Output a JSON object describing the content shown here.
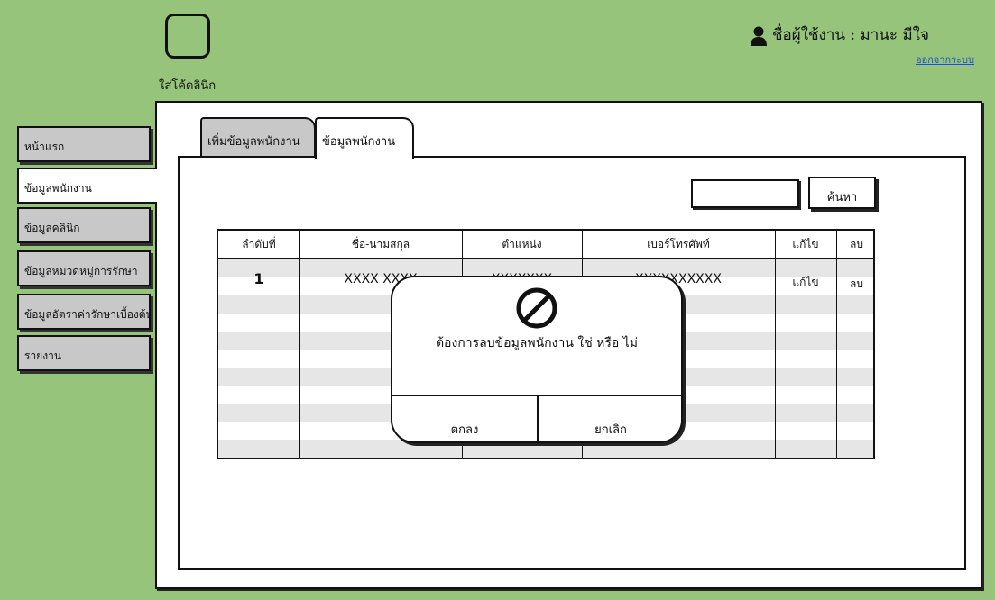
{
  "app": {
    "logo_text": "ใส่โค้ดลินิก",
    "user_text": "ชื่อผู้ใช้งาน : มานะ  มีใจ",
    "logout_label": "ออกจากระบบ"
  },
  "sidebar": {
    "items": [
      {
        "label": "หน้าแรก",
        "active": false
      },
      {
        "label": "ข้อมูลพนักงาน",
        "active": true
      },
      {
        "label": "ข้อมูลคลินิก",
        "active": false
      },
      {
        "label": "ข้อมูลหมวดหมู่การรักษา",
        "active": false
      },
      {
        "label": "ข้อมูลอัตราค่ารักษาเบื้องต้น",
        "active": false
      },
      {
        "label": "รายงาน",
        "active": false
      }
    ]
  },
  "tabs": [
    {
      "label": "เพิ่มข้อมูลพนักงาน",
      "active": false
    },
    {
      "label": "ข้อมูลพนักงาน",
      "active": true
    }
  ],
  "search": {
    "value": "",
    "button_label": "ค้นหา"
  },
  "table": {
    "headers": [
      "ลำดับที่",
      "ชื่อ-นามสกุล",
      "ตำแหน่ง",
      "เบอร์โทรศัพท์",
      "แก้ไข",
      "ลบ"
    ],
    "rows": [
      [
        "1",
        "XXXX XXXX",
        "XXXXXXX",
        "XXXXXXXXXX",
        "แก้ไข",
        "ลบ"
      ]
    ]
  },
  "dialog": {
    "icon": "prohibited-icon",
    "message": "ต้องการลบข้อมูลพนักงาน ใช่ หรือ ไม่",
    "ok_label": "ตกลง",
    "cancel_label": "ยกเลิก"
  },
  "colors": {
    "background": "#95c47a",
    "inactive": "#c8c8c8",
    "stripe": "#e6e6e6",
    "link": "#1a4fd6"
  }
}
